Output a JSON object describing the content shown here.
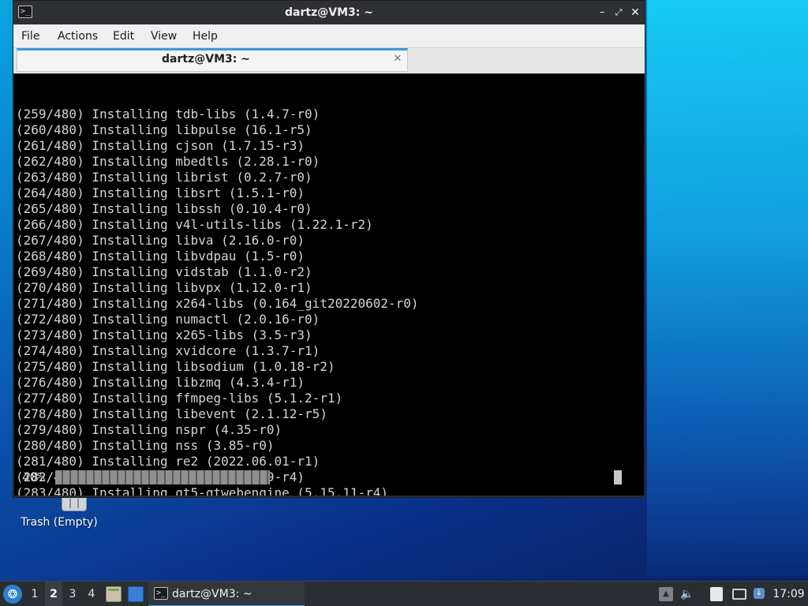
{
  "window": {
    "title": "dartz@VM3: ~",
    "app_icon_glyph": ">_",
    "minimize_glyph": "–",
    "maximize_glyph": "⤢",
    "close_glyph": "✕"
  },
  "menubar": {
    "items": [
      {
        "label": "File"
      },
      {
        "label": "Actions"
      },
      {
        "label": "Edit"
      },
      {
        "label": "View"
      },
      {
        "label": "Help"
      }
    ]
  },
  "tabs": [
    {
      "label": "dartz@VM3: ~",
      "close_glyph": "✕"
    }
  ],
  "terminal": {
    "lines": [
      "(259/480) Installing tdb-libs (1.4.7-r0)",
      "(260/480) Installing libpulse (16.1-r5)",
      "(261/480) Installing cjson (1.7.15-r3)",
      "(262/480) Installing mbedtls (2.28.1-r0)",
      "(263/480) Installing librist (0.2.7-r0)",
      "(264/480) Installing libsrt (1.5.1-r0)",
      "(265/480) Installing libssh (0.10.4-r0)",
      "(266/480) Installing v4l-utils-libs (1.22.1-r2)",
      "(267/480) Installing libva (2.16.0-r0)",
      "(268/480) Installing libvdpau (1.5-r0)",
      "(269/480) Installing vidstab (1.1.0-r2)",
      "(270/480) Installing libvpx (1.12.0-r1)",
      "(271/480) Installing x264-libs (0.164_git20220602-r0)",
      "(272/480) Installing numactl (2.0.16-r0)",
      "(273/480) Installing x265-libs (3.5-r3)",
      "(274/480) Installing xvidcore (1.3.7-r1)",
      "(275/480) Installing libsodium (1.0.18-r2)",
      "(276/480) Installing libzmq (4.3.4-r1)",
      "(277/480) Installing ffmpeg-libs (5.1.2-r1)",
      "(278/480) Installing libevent (2.1.12-r5)",
      "(279/480) Installing nspr (4.35-r0)",
      "(280/480) Installing nss (3.85-r0)",
      "(281/480) Installing re2 (2022.06.01-r1)",
      "(282/480) Installing snappy (1.1.9-r4)",
      "(283/480) Installing qt5-qtwebengine (5.15.11-r4)"
    ],
    "progress": {
      "label": "40%",
      "fraction": 0.4
    }
  },
  "desktop": {
    "icons": [
      {
        "label": "Trash (Empty)",
        "icon": "trash-icon"
      }
    ]
  },
  "taskbar": {
    "start_glyph": "❂",
    "workspaces": [
      {
        "label": "1",
        "active": false
      },
      {
        "label": "2",
        "active": true
      },
      {
        "label": "3",
        "active": false
      },
      {
        "label": "4",
        "active": false
      }
    ],
    "task": {
      "label": "dartz@VM3: ~",
      "icon": "terminal-icon"
    },
    "tray": {
      "up_glyph": "▲",
      "volume_glyph": "🔈",
      "update_glyph": "↓"
    },
    "clock": "17:09"
  },
  "colors": {
    "accent": "#3a9bd9",
    "terminal_bg": "#000000",
    "terminal_fg": "#d4d4d4",
    "titlebar": "#2e3034",
    "taskbar": "#2a2d31"
  }
}
